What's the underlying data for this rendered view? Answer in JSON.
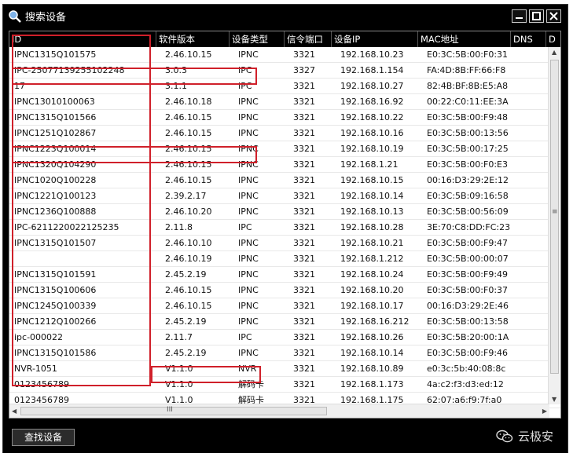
{
  "window": {
    "title": "搜索设备"
  },
  "table": {
    "columns": [
      "ID",
      "软件版本",
      "设备类型",
      "信令端口",
      "设备IP",
      "MAC地址",
      "DNS",
      "D"
    ],
    "rows": [
      [
        "IPNC1315Q101575",
        "2.46.10.15",
        "IPNC",
        "3321",
        "192.168.10.23",
        "E0:3C:5B:00:F0:31"
      ],
      [
        "IPC-25077139255102248",
        "3.0.3",
        "IPC",
        "3327",
        "192.168.1.154",
        "FA:4D:8B:FF:66:F8"
      ],
      [
        "17",
        "3.1.1",
        "IPC",
        "3321",
        "192.168.10.27",
        "82:4B:BF:8B:E5:A8"
      ],
      [
        "IPNC13010100063",
        "2.46.10.18",
        "IPNC",
        "3321",
        "192.168.16.92",
        "00:22:C0:11:EE:3A"
      ],
      [
        "IPNC1315Q101566",
        "2.46.10.15",
        "IPNC",
        "3321",
        "192.168.10.22",
        "E0:3C:5B:00:F9:48"
      ],
      [
        "IPNC1251Q102867",
        "2.46.10.15",
        "IPNC",
        "3321",
        "192.168.10.16",
        "E0:3C:5B:00:13:56"
      ],
      [
        "IPNC1223Q100014",
        "2.46.10.15",
        "IPNC",
        "3321",
        "192.168.10.19",
        "E0:3C:5B:00:17:25"
      ],
      [
        "IPNC1320Q104290",
        "2.46.10.15",
        "IPNC",
        "3321",
        "192.168.1.21",
        "E0:3C:5B:00:F0:E3"
      ],
      [
        "IPNC1020Q100228",
        "2.46.10.15",
        "IPNC",
        "3321",
        "192.168.10.15",
        "00:16:D3:29:2E:12"
      ],
      [
        "IPNC1221Q100123",
        "2.39.2.17",
        "IPNC",
        "3321",
        "192.168.10.14",
        "E0:3C:5B:09:16:58"
      ],
      [
        "IPNC1236Q100888",
        "2.46.10.20",
        "IPNC",
        "3321",
        "192.168.10.13",
        "E0:3C:5B:00:56:09"
      ],
      [
        "IPC-6211220022125235",
        "2.11.8",
        "IPC",
        "3321",
        "192.168.10.28",
        "3E:70:C8:DD:FC:23"
      ],
      [
        "IPNC1315Q101507",
        "2.46.10.10",
        "IPNC",
        "3321",
        "192.168.10.21",
        "E0:3C:5B:00:F9:47"
      ],
      [
        "",
        "2.46.10.19",
        "IPNC",
        "3321",
        "192.168.1.212",
        "E0:3C:5B:00:00:07"
      ],
      [
        "IPNC1315Q101591",
        "2.45.2.19",
        "IPNC",
        "3321",
        "192.168.10.24",
        "E0:3C:5B:00:F9:49"
      ],
      [
        "IPNC1315Q100606",
        "2.46.10.15",
        "IPNC",
        "3321",
        "192.168.10.20",
        "E0:3C:5B:00:F0:37"
      ],
      [
        "IPNC1245Q100339",
        "2.46.10.15",
        "IPNC",
        "3321",
        "192.168.10.17",
        "00:16:D3:29:2E:46"
      ],
      [
        "IPNC1212Q100266",
        "2.45.2.19",
        "IPNC",
        "3321",
        "192.168.16.212",
        "E0:3C:5B:00:13:58"
      ],
      [
        "ipc-000022",
        "2.11.7",
        "IPC",
        "3321",
        "192.168.10.26",
        "E0:3C:5B:20:00:1A"
      ],
      [
        "IPNC1315Q101586",
        "2.45.2.19",
        "IPNC",
        "3321",
        "192.168.10.14",
        "E0:3C:5B:00:F9:46"
      ],
      [
        "NVR-1051",
        "V1.1.0",
        "NVR",
        "3321",
        "192.168.10.89",
        "e0:3c:5b:40:08:8c"
      ],
      [
        "0123456789",
        "V1.1.0",
        "解码卡",
        "3321",
        "192.168.1.173",
        "4a:c2:f3:d3:ed:12"
      ],
      [
        "0123456789",
        "V1.1.0",
        "解码卡",
        "3321",
        "192.168.1.175",
        "62:07:a6:f9:7f:a0"
      ]
    ]
  },
  "scroll": {
    "h_thumb_grip": "III",
    "v_thumb_grip": "≡"
  },
  "footer": {
    "search_button": "查找设备",
    "watermark": "云极安"
  },
  "colors": {
    "highlight": "#d0202a",
    "chrome": "#000000"
  }
}
